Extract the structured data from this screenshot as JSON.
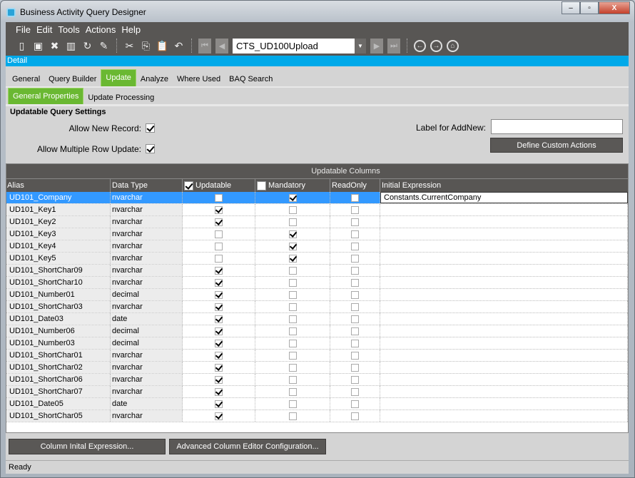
{
  "window": {
    "title": "Business Activity Query Designer",
    "min": "–",
    "max": "▫",
    "close": "X"
  },
  "menu": [
    "File",
    "Edit",
    "Tools",
    "Actions",
    "Help"
  ],
  "toolbar": {
    "query_id": "CTS_UD100Upload"
  },
  "detail_label": "Detail",
  "tabs": [
    "General",
    "Query Builder",
    "Update",
    "Analyze",
    "Where Used",
    "BAQ Search"
  ],
  "subtabs": [
    "General Properties",
    "Update Processing"
  ],
  "settings": {
    "title": "Updatable Query Settings",
    "allow_new_record": "Allow New Record:",
    "allow_new_record_checked": true,
    "allow_multi": "Allow Multiple Row Update:",
    "allow_multi_checked": true,
    "label_addnew": "Label for AddNew:",
    "label_addnew_value": "",
    "define_custom": "Define Custom Actions"
  },
  "grid": {
    "title": "Updatable Columns",
    "headers": [
      "Alias",
      "Data Type",
      "Updatable",
      "Mandatory",
      "ReadOnly",
      "Initial Expression"
    ],
    "rows": [
      {
        "alias": "UD101_Company",
        "type": "nvarchar",
        "u": false,
        "m": true,
        "r": false,
        "expr": "Constants.CurrentCompany"
      },
      {
        "alias": "UD101_Key1",
        "type": "nvarchar",
        "u": true,
        "m": false,
        "r": false,
        "expr": ""
      },
      {
        "alias": "UD101_Key2",
        "type": "nvarchar",
        "u": true,
        "m": false,
        "r": false,
        "expr": ""
      },
      {
        "alias": "UD101_Key3",
        "type": "nvarchar",
        "u": false,
        "m": true,
        "r": false,
        "expr": ""
      },
      {
        "alias": "UD101_Key4",
        "type": "nvarchar",
        "u": false,
        "m": true,
        "r": false,
        "expr": ""
      },
      {
        "alias": "UD101_Key5",
        "type": "nvarchar",
        "u": false,
        "m": true,
        "r": false,
        "expr": ""
      },
      {
        "alias": "UD101_ShortChar09",
        "type": "nvarchar",
        "u": true,
        "m": false,
        "r": false,
        "expr": ""
      },
      {
        "alias": "UD101_ShortChar10",
        "type": "nvarchar",
        "u": true,
        "m": false,
        "r": false,
        "expr": ""
      },
      {
        "alias": "UD101_Number01",
        "type": "decimal",
        "u": true,
        "m": false,
        "r": false,
        "expr": ""
      },
      {
        "alias": "UD101_ShortChar03",
        "type": "nvarchar",
        "u": true,
        "m": false,
        "r": false,
        "expr": ""
      },
      {
        "alias": "UD101_Date03",
        "type": "date",
        "u": true,
        "m": false,
        "r": false,
        "expr": ""
      },
      {
        "alias": "UD101_Number06",
        "type": "decimal",
        "u": true,
        "m": false,
        "r": false,
        "expr": ""
      },
      {
        "alias": "UD101_Number03",
        "type": "decimal",
        "u": true,
        "m": false,
        "r": false,
        "expr": ""
      },
      {
        "alias": "UD101_ShortChar01",
        "type": "nvarchar",
        "u": true,
        "m": false,
        "r": false,
        "expr": ""
      },
      {
        "alias": "UD101_ShortChar02",
        "type": "nvarchar",
        "u": true,
        "m": false,
        "r": false,
        "expr": ""
      },
      {
        "alias": "UD101_ShortChar06",
        "type": "nvarchar",
        "u": true,
        "m": false,
        "r": false,
        "expr": ""
      },
      {
        "alias": "UD101_ShortChar07",
        "type": "nvarchar",
        "u": true,
        "m": false,
        "r": false,
        "expr": ""
      },
      {
        "alias": "UD101_Date05",
        "type": "date",
        "u": true,
        "m": false,
        "r": false,
        "expr": ""
      },
      {
        "alias": "UD101_ShortChar05",
        "type": "nvarchar",
        "u": true,
        "m": false,
        "r": false,
        "expr": ""
      }
    ]
  },
  "buttons": {
    "col_init": "Column Inital Expression...",
    "adv_editor": "Advanced Column Editor Configuration..."
  },
  "status": "Ready"
}
